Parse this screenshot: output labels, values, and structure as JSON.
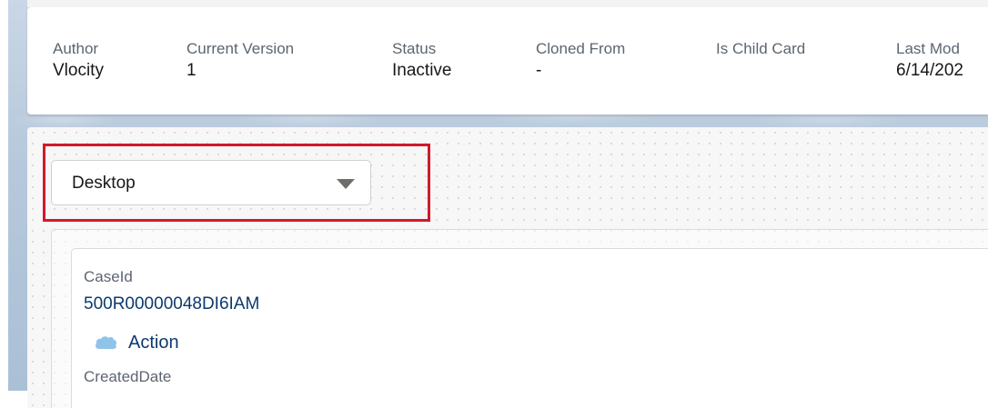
{
  "header": {
    "fields": [
      {
        "label": "Author",
        "value": "Vlocity"
      },
      {
        "label": "Current Version",
        "value": "1"
      },
      {
        "label": "Status",
        "value": "Inactive"
      },
      {
        "label": "Cloned From",
        "value": "-"
      },
      {
        "label": "Is Child Card",
        "value": ""
      },
      {
        "label": "Last Mod",
        "value": "6/14/202"
      }
    ]
  },
  "device_select": {
    "selected": "Desktop",
    "icon": "chevron-down-icon"
  },
  "card": {
    "field1_label": "CaseId",
    "field1_value": "500R00000048DI6IAM",
    "action_label": "Action",
    "action_icon": "cloud-icon",
    "field2_label": "CreatedDate"
  },
  "colors": {
    "highlight": "#d11a2a",
    "link_text": "#0c3a6e",
    "background": "#b7c9dc"
  }
}
